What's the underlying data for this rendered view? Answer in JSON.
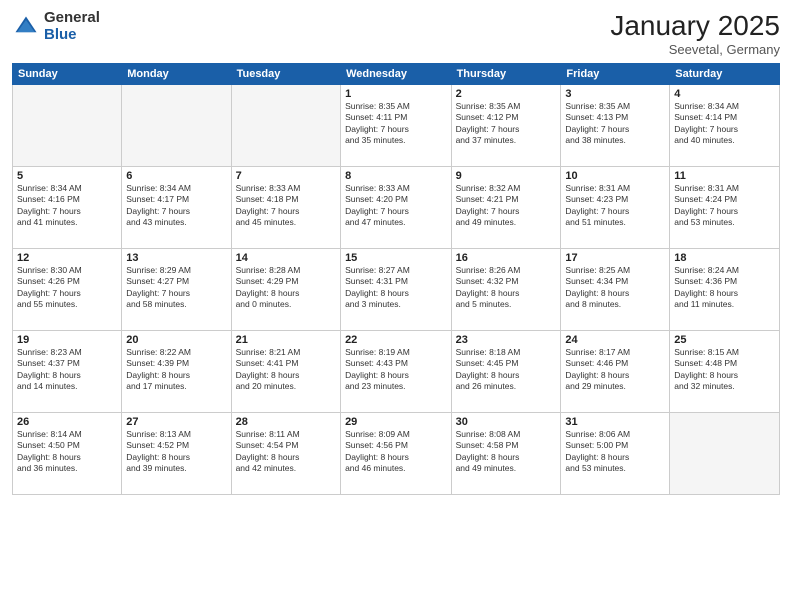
{
  "header": {
    "logo_general": "General",
    "logo_blue": "Blue",
    "month_title": "January 2025",
    "location": "Seevetal, Germany"
  },
  "weekdays": [
    "Sunday",
    "Monday",
    "Tuesday",
    "Wednesday",
    "Thursday",
    "Friday",
    "Saturday"
  ],
  "weeks": [
    [
      {
        "day": "",
        "text": ""
      },
      {
        "day": "",
        "text": ""
      },
      {
        "day": "",
        "text": ""
      },
      {
        "day": "1",
        "text": "Sunrise: 8:35 AM\nSunset: 4:11 PM\nDaylight: 7 hours\nand 35 minutes."
      },
      {
        "day": "2",
        "text": "Sunrise: 8:35 AM\nSunset: 4:12 PM\nDaylight: 7 hours\nand 37 minutes."
      },
      {
        "day": "3",
        "text": "Sunrise: 8:35 AM\nSunset: 4:13 PM\nDaylight: 7 hours\nand 38 minutes."
      },
      {
        "day": "4",
        "text": "Sunrise: 8:34 AM\nSunset: 4:14 PM\nDaylight: 7 hours\nand 40 minutes."
      }
    ],
    [
      {
        "day": "5",
        "text": "Sunrise: 8:34 AM\nSunset: 4:16 PM\nDaylight: 7 hours\nand 41 minutes."
      },
      {
        "day": "6",
        "text": "Sunrise: 8:34 AM\nSunset: 4:17 PM\nDaylight: 7 hours\nand 43 minutes."
      },
      {
        "day": "7",
        "text": "Sunrise: 8:33 AM\nSunset: 4:18 PM\nDaylight: 7 hours\nand 45 minutes."
      },
      {
        "day": "8",
        "text": "Sunrise: 8:33 AM\nSunset: 4:20 PM\nDaylight: 7 hours\nand 47 minutes."
      },
      {
        "day": "9",
        "text": "Sunrise: 8:32 AM\nSunset: 4:21 PM\nDaylight: 7 hours\nand 49 minutes."
      },
      {
        "day": "10",
        "text": "Sunrise: 8:31 AM\nSunset: 4:23 PM\nDaylight: 7 hours\nand 51 minutes."
      },
      {
        "day": "11",
        "text": "Sunrise: 8:31 AM\nSunset: 4:24 PM\nDaylight: 7 hours\nand 53 minutes."
      }
    ],
    [
      {
        "day": "12",
        "text": "Sunrise: 8:30 AM\nSunset: 4:26 PM\nDaylight: 7 hours\nand 55 minutes."
      },
      {
        "day": "13",
        "text": "Sunrise: 8:29 AM\nSunset: 4:27 PM\nDaylight: 7 hours\nand 58 minutes."
      },
      {
        "day": "14",
        "text": "Sunrise: 8:28 AM\nSunset: 4:29 PM\nDaylight: 8 hours\nand 0 minutes."
      },
      {
        "day": "15",
        "text": "Sunrise: 8:27 AM\nSunset: 4:31 PM\nDaylight: 8 hours\nand 3 minutes."
      },
      {
        "day": "16",
        "text": "Sunrise: 8:26 AM\nSunset: 4:32 PM\nDaylight: 8 hours\nand 5 minutes."
      },
      {
        "day": "17",
        "text": "Sunrise: 8:25 AM\nSunset: 4:34 PM\nDaylight: 8 hours\nand 8 minutes."
      },
      {
        "day": "18",
        "text": "Sunrise: 8:24 AM\nSunset: 4:36 PM\nDaylight: 8 hours\nand 11 minutes."
      }
    ],
    [
      {
        "day": "19",
        "text": "Sunrise: 8:23 AM\nSunset: 4:37 PM\nDaylight: 8 hours\nand 14 minutes."
      },
      {
        "day": "20",
        "text": "Sunrise: 8:22 AM\nSunset: 4:39 PM\nDaylight: 8 hours\nand 17 minutes."
      },
      {
        "day": "21",
        "text": "Sunrise: 8:21 AM\nSunset: 4:41 PM\nDaylight: 8 hours\nand 20 minutes."
      },
      {
        "day": "22",
        "text": "Sunrise: 8:19 AM\nSunset: 4:43 PM\nDaylight: 8 hours\nand 23 minutes."
      },
      {
        "day": "23",
        "text": "Sunrise: 8:18 AM\nSunset: 4:45 PM\nDaylight: 8 hours\nand 26 minutes."
      },
      {
        "day": "24",
        "text": "Sunrise: 8:17 AM\nSunset: 4:46 PM\nDaylight: 8 hours\nand 29 minutes."
      },
      {
        "day": "25",
        "text": "Sunrise: 8:15 AM\nSunset: 4:48 PM\nDaylight: 8 hours\nand 32 minutes."
      }
    ],
    [
      {
        "day": "26",
        "text": "Sunrise: 8:14 AM\nSunset: 4:50 PM\nDaylight: 8 hours\nand 36 minutes."
      },
      {
        "day": "27",
        "text": "Sunrise: 8:13 AM\nSunset: 4:52 PM\nDaylight: 8 hours\nand 39 minutes."
      },
      {
        "day": "28",
        "text": "Sunrise: 8:11 AM\nSunset: 4:54 PM\nDaylight: 8 hours\nand 42 minutes."
      },
      {
        "day": "29",
        "text": "Sunrise: 8:09 AM\nSunset: 4:56 PM\nDaylight: 8 hours\nand 46 minutes."
      },
      {
        "day": "30",
        "text": "Sunrise: 8:08 AM\nSunset: 4:58 PM\nDaylight: 8 hours\nand 49 minutes."
      },
      {
        "day": "31",
        "text": "Sunrise: 8:06 AM\nSunset: 5:00 PM\nDaylight: 8 hours\nand 53 minutes."
      },
      {
        "day": "",
        "text": ""
      }
    ]
  ]
}
